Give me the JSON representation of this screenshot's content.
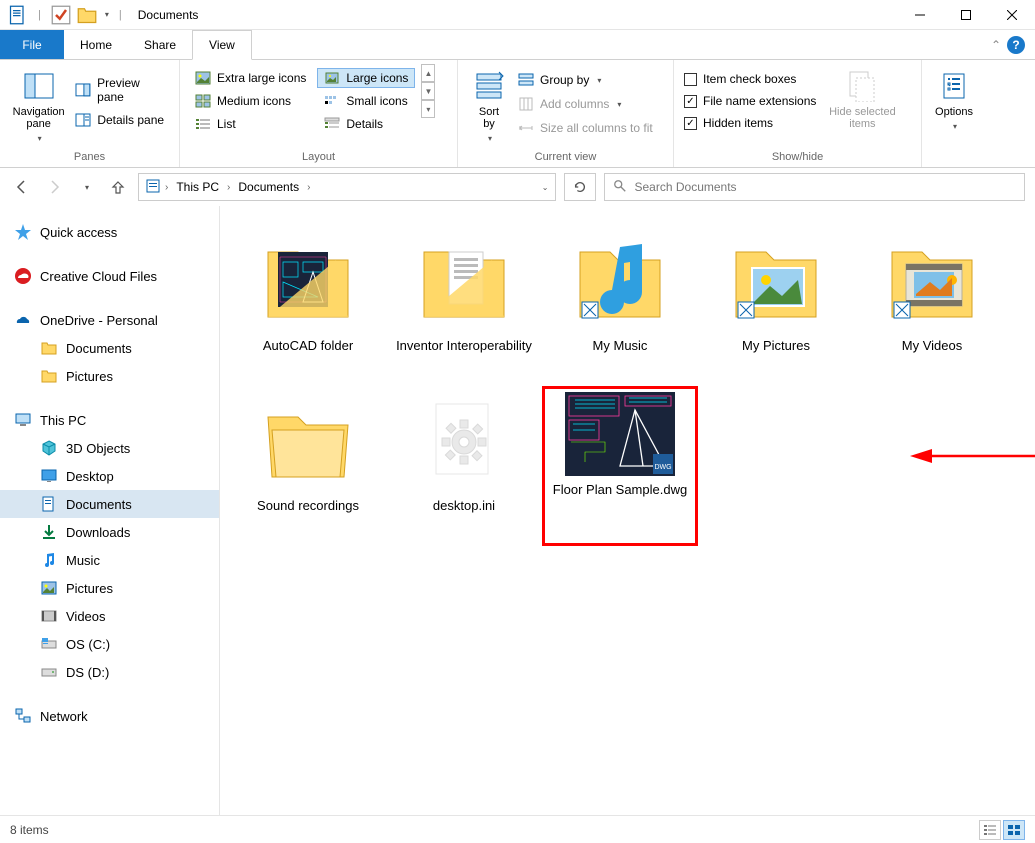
{
  "titlebar": {
    "title": "Documents"
  },
  "ribbon_tabs": {
    "file": "File",
    "home": "Home",
    "share": "Share",
    "view": "View"
  },
  "ribbon": {
    "panes": {
      "navigation": "Navigation\npane",
      "preview": "Preview pane",
      "details": "Details pane",
      "group_label": "Panes"
    },
    "layout": {
      "extra_large": "Extra large icons",
      "large": "Large icons",
      "medium": "Medium icons",
      "small": "Small icons",
      "list": "List",
      "details": "Details",
      "group_label": "Layout"
    },
    "current_view": {
      "sort_by": "Sort\nby",
      "group_by": "Group by",
      "add_columns": "Add columns",
      "size_all": "Size all columns to fit",
      "group_label": "Current view"
    },
    "show_hide": {
      "item_check": "Item check boxes",
      "file_ext": "File name extensions",
      "hidden": "Hidden items",
      "hide_selected": "Hide selected\nitems",
      "group_label": "Show/hide"
    },
    "options": "Options"
  },
  "address": {
    "crumbs": [
      "This PC",
      "Documents"
    ],
    "search_placeholder": "Search Documents"
  },
  "nav_pane": {
    "quick_access": "Quick access",
    "creative_cloud": "Creative Cloud Files",
    "onedrive": "OneDrive - Personal",
    "onedrive_docs": "Documents",
    "onedrive_pics": "Pictures",
    "this_pc": "This PC",
    "pc_3d": "3D Objects",
    "pc_desktop": "Desktop",
    "pc_documents": "Documents",
    "pc_downloads": "Downloads",
    "pc_music": "Music",
    "pc_pictures": "Pictures",
    "pc_videos": "Videos",
    "pc_osc": "OS (C:)",
    "pc_dsd": "DS (D:)",
    "network": "Network"
  },
  "files": [
    {
      "name": "AutoCAD folder",
      "type": "folder-cad"
    },
    {
      "name": "Inventor Interoperability",
      "type": "folder-doc"
    },
    {
      "name": "My Music",
      "type": "folder-music"
    },
    {
      "name": "My Pictures",
      "type": "folder-pictures"
    },
    {
      "name": "My Videos",
      "type": "folder-videos"
    },
    {
      "name": "Sound recordings",
      "type": "folder"
    },
    {
      "name": "desktop.ini",
      "type": "ini"
    },
    {
      "name": "Floor Plan Sample.dwg",
      "type": "dwg",
      "highlighted": true
    }
  ],
  "status": {
    "item_count": "8 items"
  }
}
